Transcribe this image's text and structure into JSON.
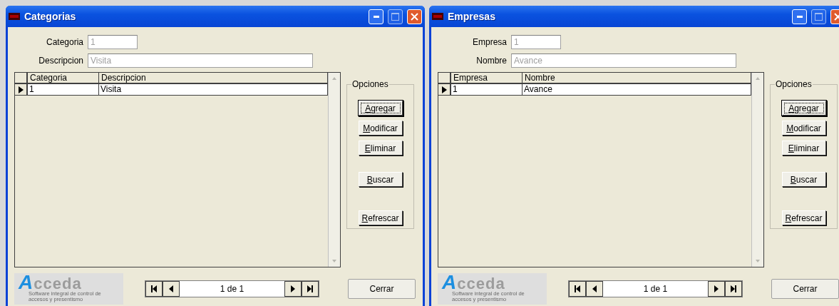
{
  "windows": [
    {
      "title": "Categorias",
      "fields": [
        {
          "label": "Categoria",
          "value": "1",
          "disabled": true
        },
        {
          "label": "Descripcion",
          "value": "Visita",
          "disabled": true
        }
      ],
      "table": {
        "columns": [
          "Categoria",
          "Descripcion"
        ],
        "rows": [
          {
            "cells": [
              "1",
              "Visita"
            ],
            "selected": true
          }
        ]
      },
      "options": {
        "title": "Opciones",
        "buttons": [
          {
            "label": "Agregar",
            "focused": true
          },
          {
            "label": "Modificar",
            "focused": false
          },
          {
            "label": "Eliminar",
            "focused": false
          },
          {
            "label": "Buscar",
            "focused": false
          },
          {
            "label": "Refrescar",
            "focused": false
          }
        ]
      },
      "logo": {
        "name": "Acceda",
        "tagline": "Software integral de control de accesos y presentismo"
      },
      "navigator": {
        "position": "1 de 1"
      },
      "close_button": "Cerrar"
    },
    {
      "title": "Empresas",
      "fields": [
        {
          "label": "Empresa",
          "value": "1",
          "disabled": true
        },
        {
          "label": "Nombre",
          "value": "Avance",
          "disabled": true
        }
      ],
      "table": {
        "columns": [
          "Empresa",
          "Nombre"
        ],
        "rows": [
          {
            "cells": [
              "1",
              "Avance"
            ],
            "selected": true
          }
        ]
      },
      "options": {
        "title": "Opciones",
        "buttons": [
          {
            "label": "Agregar",
            "focused": true
          },
          {
            "label": "Modificar",
            "focused": false
          },
          {
            "label": "Eliminar",
            "focused": false
          },
          {
            "label": "Buscar",
            "focused": false
          },
          {
            "label": "Refrescar",
            "focused": false
          }
        ]
      },
      "logo": {
        "name": "Acceda",
        "tagline": "Software integral de control de accesos y presentismo"
      },
      "navigator": {
        "position": "1 de 1"
      },
      "close_button": "Cerrar"
    }
  ]
}
